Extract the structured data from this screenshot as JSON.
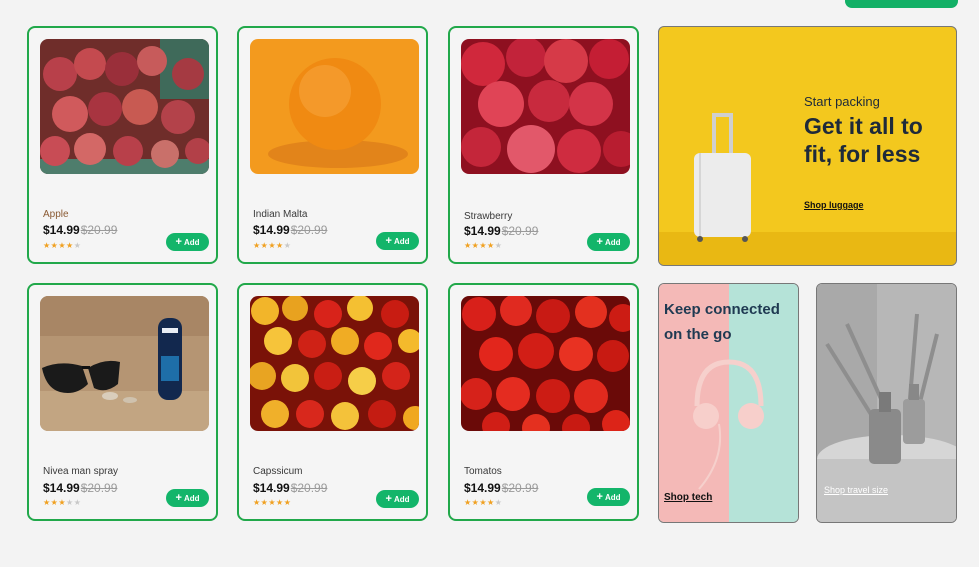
{
  "products": [
    {
      "name": "Apple",
      "price": "$14.99",
      "old_price": "$20.99",
      "rating": 4,
      "add_label": "Add",
      "image": "apples"
    },
    {
      "name": "Indian Malta",
      "price": "$14.99",
      "old_price": "$20.99",
      "rating": 4,
      "add_label": "Add",
      "image": "orange"
    },
    {
      "name": "Strawberry",
      "price": "$14.99",
      "old_price": "$20.99",
      "rating": 4,
      "add_label": "Add",
      "image": "raspberries"
    },
    {
      "name": "Nivea man spray",
      "price": "$14.99",
      "old_price": "$20.99",
      "rating": 3,
      "add_label": "Add",
      "image": "sunglasses-deodorant"
    },
    {
      "name": "Capssicum",
      "price": "$14.99",
      "old_price": "$20.99",
      "rating": 5,
      "add_label": "Add",
      "image": "peppers"
    },
    {
      "name": "Tomatos",
      "price": "$14.99",
      "old_price": "$20.99",
      "rating": 4,
      "add_label": "Add",
      "image": "tomatoes"
    }
  ],
  "promos": {
    "luggage": {
      "kicker": "Start packing",
      "headline": "Get it all to fit, for less",
      "link": "Shop luggage"
    },
    "tech": {
      "headline": "Keep connected on the go",
      "link": "Shop tech"
    },
    "travel": {
      "link": "Shop travel size"
    }
  },
  "colors": {
    "accent": "#13b56a",
    "card_border": "#21a84a",
    "star": "#f0a020",
    "luggage_bg": "#f3c81e"
  },
  "icons": {
    "add": "plus-icon",
    "rating": "star-icon"
  }
}
